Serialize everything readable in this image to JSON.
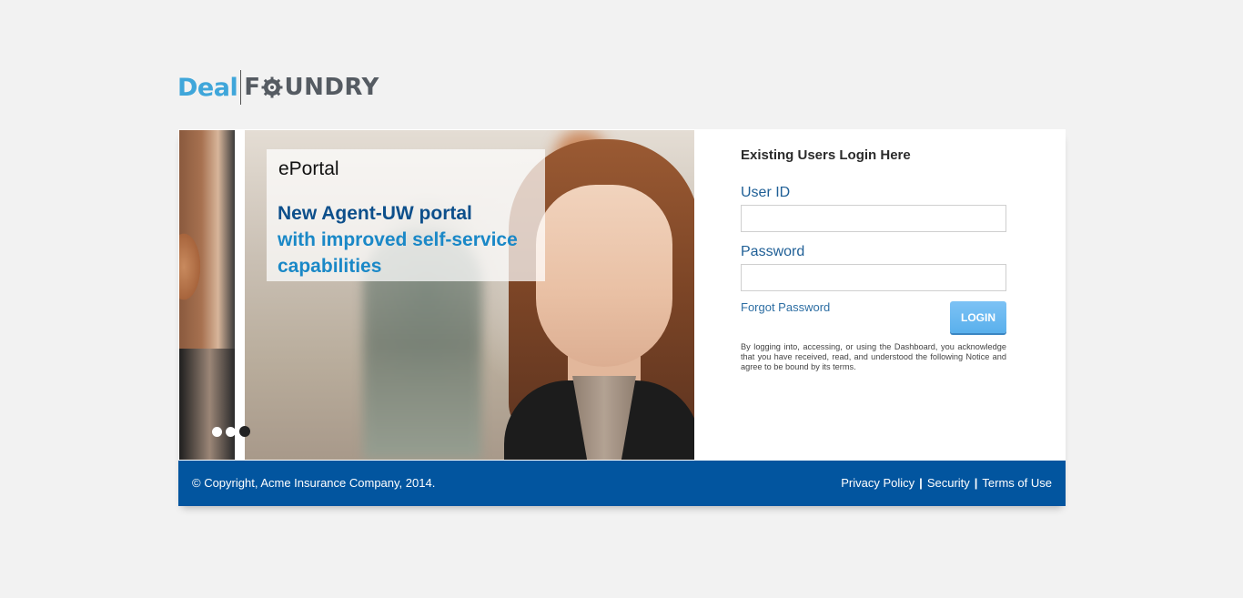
{
  "logo": {
    "part1": "Deal",
    "part2_prefix": "F",
    "part2_suffix": "UNDRY"
  },
  "carousel": {
    "caption_title": "ePortal",
    "caption_line1": "New Agent-UW portal",
    "caption_line2": "with improved self-service",
    "caption_line3": "capabilities",
    "slide_count": 3,
    "active_slide": 3
  },
  "login": {
    "title": "Existing Users Login Here",
    "user_label": "User ID",
    "user_value": "",
    "password_label": "Password",
    "password_value": "",
    "forgot_label": "Forgot Password",
    "button_label": "LOGIN",
    "notice": "By logging into, accessing, or using the Dashboard, you acknowledge that you have received, read, and understood the following Notice and agree to be bound by its terms."
  },
  "footer": {
    "copyright": "© Copyright, Acme Insurance Company, 2014.",
    "links": [
      "Privacy Policy",
      "Security",
      "Terms of Use"
    ],
    "separator": "|"
  },
  "colors": {
    "brand_blue": "#02559f",
    "accent_light_blue": "#3fa6da",
    "button": "#5ab0ec",
    "background": "#f2f2f2"
  }
}
